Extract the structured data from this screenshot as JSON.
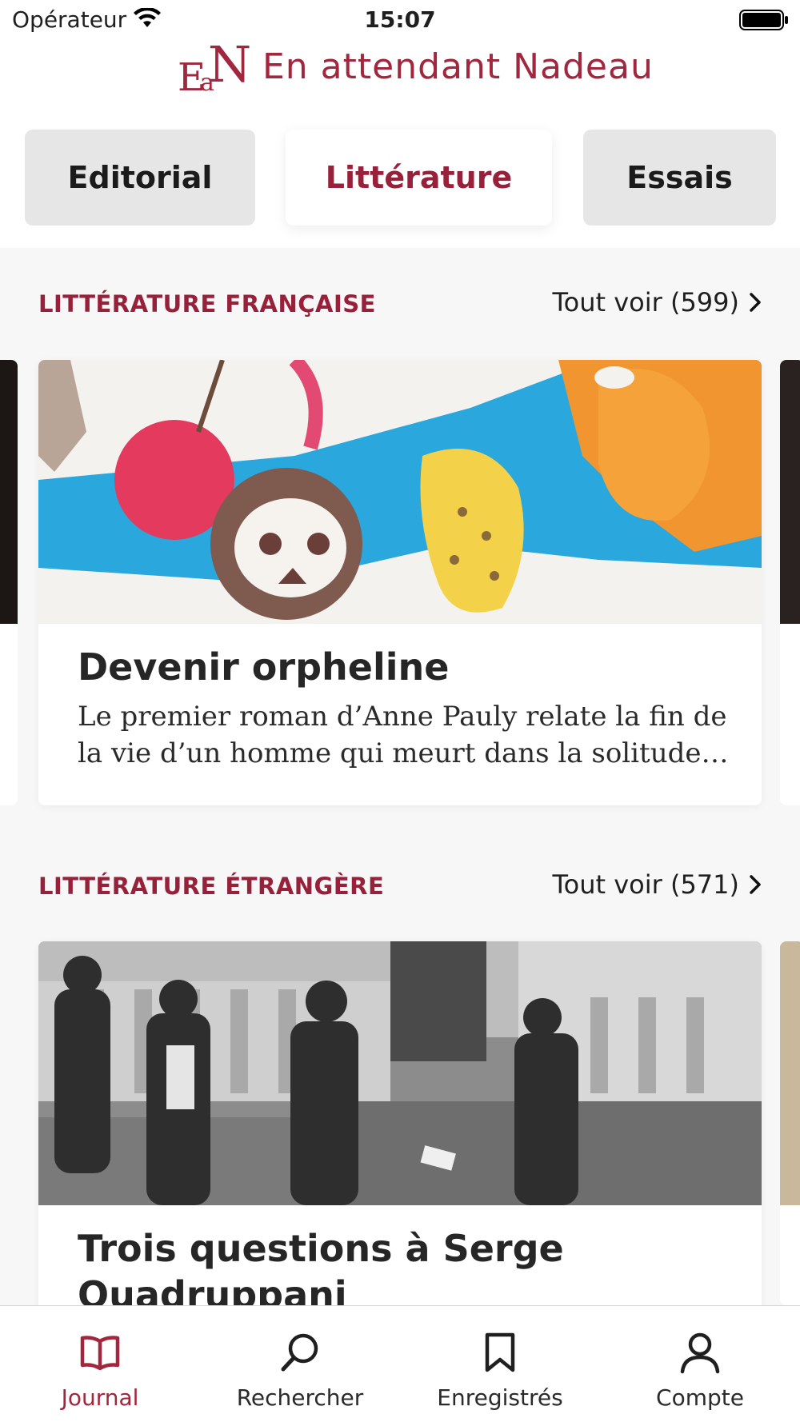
{
  "status_bar": {
    "carrier": "Opérateur",
    "time": "15:07"
  },
  "header": {
    "logo_text": "En attendant Nadeau",
    "logo_mark": "EaN",
    "brand_color": "#a0273e"
  },
  "tabs": [
    {
      "label": "Editorial",
      "active": false
    },
    {
      "label": "Littérature",
      "active": true
    },
    {
      "label": "Essais",
      "active": false
    }
  ],
  "sections": [
    {
      "title": "LITTÉRATURE FRANÇAISE",
      "see_all": "Tout voir (599)",
      "card": {
        "title": "Devenir orpheline",
        "description": "Le premier roman d’Anne Pauly relate la fin de la vie d’un homme qui meurt dans la solitude…",
        "image": "watercolor-painting"
      }
    },
    {
      "title": "LITTÉRATURE ÉTRANGÈRE",
      "see_all": "Tout voir (571)",
      "card": {
        "title": "Trois questions à Serge Quadruppani",
        "image": "black-and-white-photo-men-street"
      }
    }
  ],
  "tab_bar": [
    {
      "label": "Journal",
      "icon": "open-book-icon",
      "active": true
    },
    {
      "label": "Rechercher",
      "icon": "search-icon",
      "active": false
    },
    {
      "label": "Enregistrés",
      "icon": "bookmark-icon",
      "active": false
    },
    {
      "label": "Compte",
      "icon": "user-icon",
      "active": false
    }
  ]
}
